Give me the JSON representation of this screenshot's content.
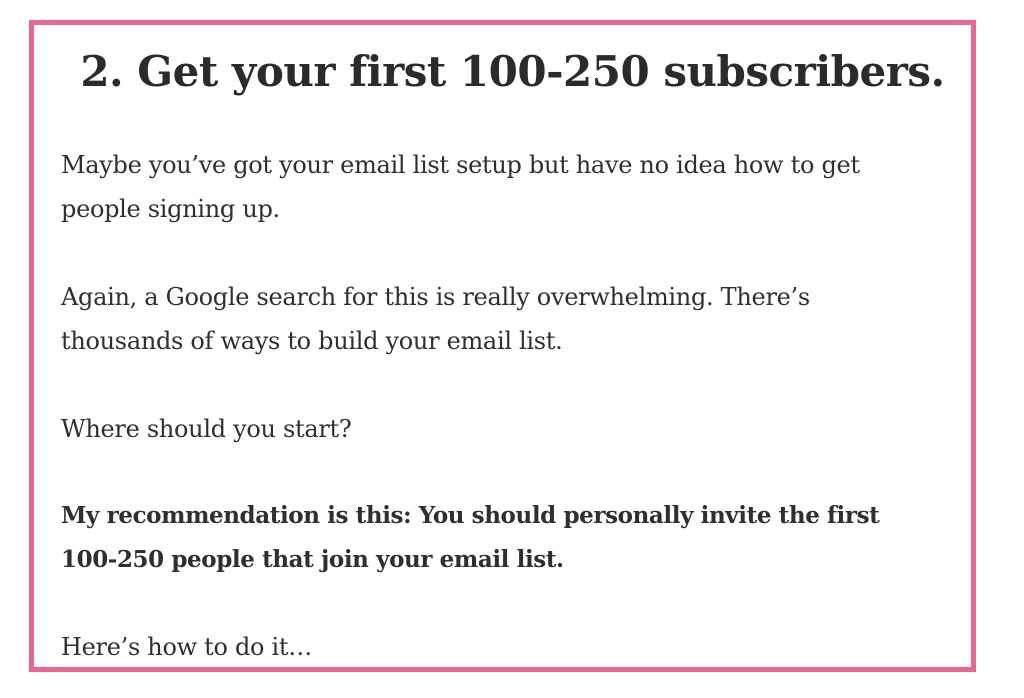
{
  "heading": "2. Get your first 100-250 subscribers.",
  "paragraphs": [
    {
      "lines": [
        "Maybe you’ve got your email list setup but have no idea how to get",
        "people signing up."
      ]
    },
    {
      "lines": [
        "Again, a Google search for this is really overwhelming. There’s",
        "thousands of ways to build your email list."
      ]
    },
    {
      "lines": [
        "Where should you start?"
      ]
    },
    {
      "lines": [
        "My recommendation is this: You should personally invite the first",
        "100-250 people that join your email list."
      ]
    },
    {
      "lines": [
        "Here’s how to do it…"
      ]
    }
  ],
  "colors": {
    "frame_border": "#e8678f",
    "text": "#2f2f2f",
    "heading": "#2b2b2b",
    "background": "#ffffff"
  }
}
